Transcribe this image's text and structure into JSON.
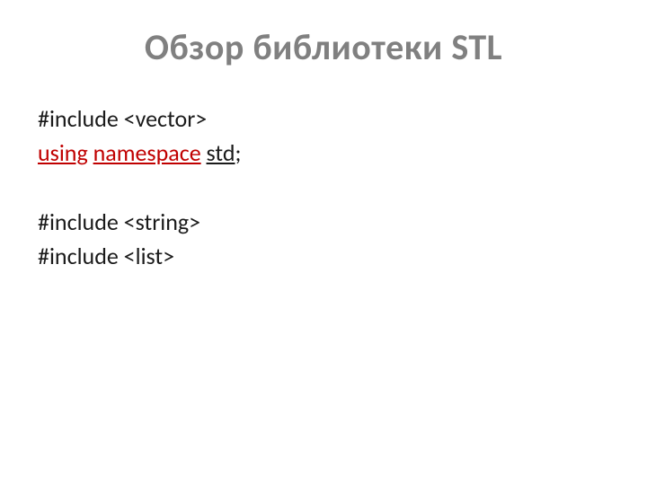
{
  "title": "Обзор библиотеки STL",
  "lines": {
    "l1": "#include <vector>",
    "l2a": "using",
    "l2b": "namespace",
    "l2c": "std",
    "l2d": ";",
    "l3": "#include <string>",
    "l4": "#include <list>"
  }
}
